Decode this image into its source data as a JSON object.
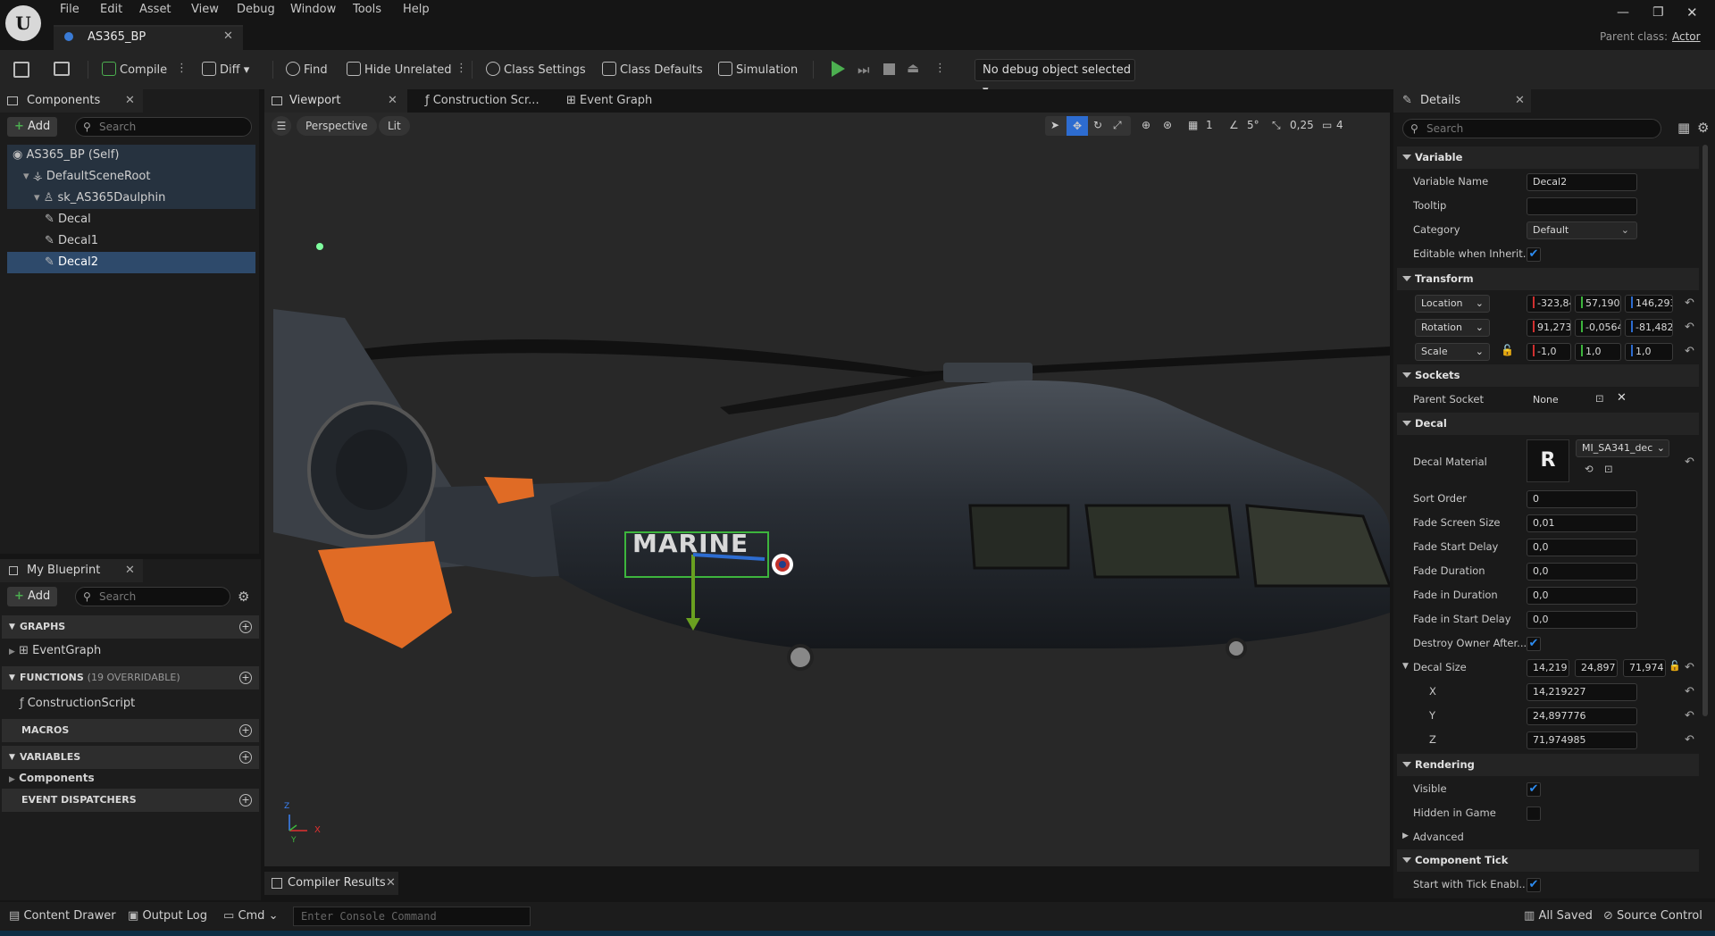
{
  "app": {
    "tab_title": "AS365_BP",
    "parent_class_label": "Parent class:",
    "parent_class_value": "Actor",
    "menu": [
      "File",
      "Edit",
      "Asset",
      "View",
      "Debug",
      "Window",
      "Tools",
      "Help"
    ]
  },
  "toolbar": {
    "compile": "Compile",
    "diff": "Diff",
    "find": "Find",
    "hide_unrelated": "Hide Unrelated",
    "class_settings": "Class Settings",
    "class_defaults": "Class Defaults",
    "simulation": "Simulation",
    "debug_object": "No debug object selected"
  },
  "components": {
    "title": "Components",
    "add": "Add",
    "search_placeholder": "Search",
    "tree": [
      {
        "label": "AS365_BP (Self)",
        "indent": 0,
        "icon": "actor-icon"
      },
      {
        "label": "DefaultSceneRoot",
        "indent": 1,
        "icon": "scene-root-icon"
      },
      {
        "label": "sk_AS365Daulphin",
        "indent": 2,
        "icon": "skeletal-mesh-icon"
      },
      {
        "label": "Decal",
        "indent": 3,
        "icon": "decal-icon"
      },
      {
        "label": "Decal1",
        "indent": 3,
        "icon": "decal-icon"
      },
      {
        "label": "Decal2",
        "indent": 3,
        "icon": "decal-icon",
        "selected": true
      }
    ]
  },
  "my_blueprint": {
    "title": "My Blueprint",
    "add": "Add",
    "search_placeholder": "Search",
    "graphs": "GRAPHS",
    "event_graph": "EventGraph",
    "functions": "FUNCTIONS",
    "functions_count": "(19 OVERRIDABLE)",
    "construction_script": "ConstructionScript",
    "macros": "MACROS",
    "variables": "VARIABLES",
    "components": "Components",
    "event_dispatchers": "EVENT DISPATCHERS"
  },
  "editor_tabs": {
    "viewport": "Viewport",
    "construction": "Construction Scr...",
    "event_graph": "Event Graph"
  },
  "viewport": {
    "perspective": "Perspective",
    "lit": "Lit",
    "grid_value": "1",
    "angle_value": "5°",
    "scale_value": "0,25",
    "camera_speed": "4",
    "decal_text": "MARINE",
    "axis_x": "X",
    "axis_y": "Y",
    "axis_z": "Z"
  },
  "compiler": {
    "title": "Compiler Results"
  },
  "details": {
    "title": "Details",
    "search_placeholder": "Search",
    "variable": {
      "section": "Variable",
      "name_label": "Variable Name",
      "name_value": "Decal2",
      "tooltip_label": "Tooltip",
      "tooltip_value": "",
      "category_label": "Category",
      "category_value": "Default",
      "editable_label": "Editable when Inherit..."
    },
    "transform": {
      "section": "Transform",
      "location": "Location",
      "loc": [
        "-323,84",
        "57,1909",
        "146,293"
      ],
      "rotation": "Rotation",
      "rot": [
        "91,2737",
        "-0,0564",
        "-81,482"
      ],
      "scale": "Scale",
      "scl": [
        "-1,0",
        "1,0",
        "1,0"
      ]
    },
    "sockets": {
      "section": "Sockets",
      "parent_label": "Parent Socket",
      "parent_value": "None"
    },
    "decal": {
      "section": "Decal",
      "material_label": "Decal Material",
      "material_value": "MI_SA341_dec",
      "sort_label": "Sort Order",
      "sort_value": "0",
      "fade_screen_label": "Fade Screen Size",
      "fade_screen_value": "0,01",
      "fade_start_label": "Fade Start Delay",
      "fade_start_value": "0,0",
      "fade_duration_label": "Fade Duration",
      "fade_duration_value": "0,0",
      "fade_in_label": "Fade in Duration",
      "fade_in_value": "0,0",
      "fade_in_start_label": "Fade in Start Delay",
      "fade_in_start_value": "0,0",
      "destroy_label": "Destroy Owner After...",
      "size_label": "Decal Size",
      "size_short": [
        "14,219",
        "24,897",
        "71,974"
      ],
      "x_label": "X",
      "x_value": "14,219227",
      "y_label": "Y",
      "y_value": "24,897776",
      "z_label": "Z",
      "z_value": "71,974985"
    },
    "rendering": {
      "section": "Rendering",
      "visible_label": "Visible",
      "hidden_label": "Hidden in Game",
      "advanced_label": "Advanced"
    },
    "tick": {
      "section": "Component Tick",
      "start_label": "Start with Tick Enabl..."
    }
  },
  "status": {
    "content_drawer": "Content Drawer",
    "output_log": "Output Log",
    "cmd": "Cmd",
    "console_placeholder": "Enter Console Command",
    "all_saved": "All Saved",
    "source_control": "Source Control"
  },
  "colors": {
    "accent": "#2d8cf0",
    "selected_row": "#2e4a6b",
    "play_green": "#4caf50",
    "orange": "#e06b25"
  }
}
